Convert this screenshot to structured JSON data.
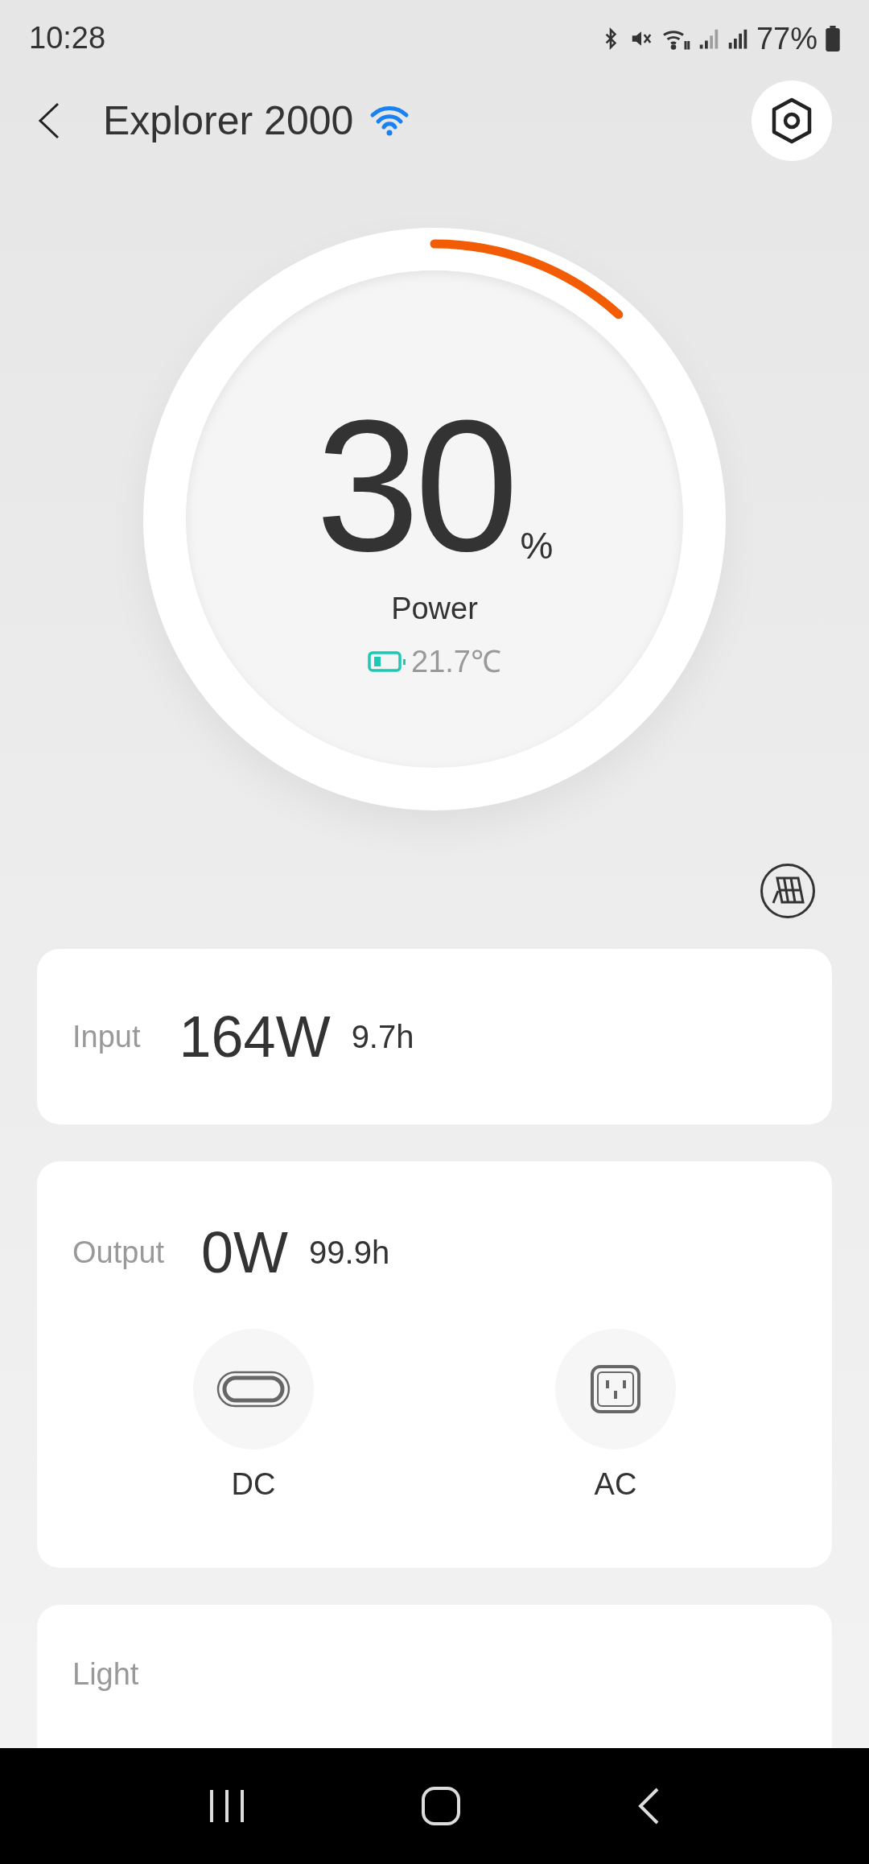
{
  "status_bar": {
    "time": "10:28",
    "battery": "77%"
  },
  "header": {
    "title": "Explorer 2000"
  },
  "gauge": {
    "value": "30",
    "unit": "%",
    "label": "Power",
    "temperature": "21.7℃"
  },
  "input": {
    "label": "Input",
    "power": "164W",
    "time": "9.7h"
  },
  "output": {
    "label": "Output",
    "power": "0W",
    "time": "99.9h",
    "ports": [
      {
        "kind": "dc",
        "label": "DC",
        "on": false
      },
      {
        "kind": "ac",
        "label": "AC",
        "on": false
      }
    ]
  },
  "light": {
    "label": "Light"
  }
}
